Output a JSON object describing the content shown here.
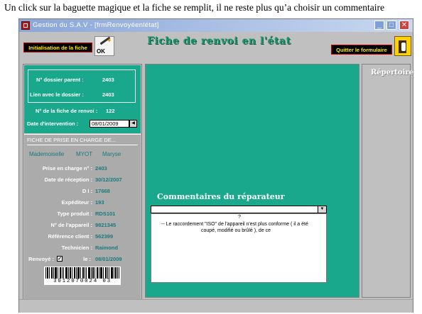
{
  "caption": "Un click sur la baguette magique et la fiche se remplit, il ne reste plus qu’a choisir un commentaire",
  "window": {
    "title": "Gestion du S.A.V - [frmRenvoyéenlétat]",
    "minimize": "_",
    "maximize": "□",
    "close": "✕"
  },
  "toolbar": {
    "init_button": "Initialisation de la fiche",
    "wand_label": "OK",
    "main_title": "Fiche de renvoi en l'état",
    "quit_button": "Quitter le formulaire"
  },
  "dossier": {
    "parent_label": "N° dossier parent :",
    "parent_value": "2403",
    "link_label": "Lien avec le dossier :",
    "link_value": "2403",
    "fiche_label": "N° de la fiche de renvoi :",
    "fiche_value": "122",
    "date_label": "Date d'intervention :",
    "date_value": "08/01/2009"
  },
  "prise_en_charge": {
    "header": "FICHE DE PRISE EN CHARGE DE...",
    "civility": "Mademoiselle",
    "lastname": "MYOT",
    "firstname": "Maryse",
    "fields": [
      {
        "label": "Prise en charge n° :",
        "value": "2403"
      },
      {
        "label": "Date de réception :",
        "value": "30/12/2007"
      },
      {
        "label": "D I :",
        "value": "17668"
      },
      {
        "label": "Expéditeur :",
        "value": "193"
      },
      {
        "label": "Type produit :",
        "value": "RDS101"
      },
      {
        "label": "N° de l'appareil :",
        "value": "9821345"
      },
      {
        "label": "Référence client :",
        "value": "562399"
      },
      {
        "label": "Technicien :",
        "value": "Raimond"
      }
    ],
    "renvoye_label": "Renvoyé :",
    "renvoye_checked": "✓",
    "le_label": "le :",
    "le_value": "08/01/2009",
    "barcode_digits": "3012070024 03"
  },
  "comments": {
    "title": "Commentaires du réparateur",
    "question_mark": "?",
    "line1": "-- Le raccordement \"ISO\" de l'appareil n'est plus conforme ( il a été",
    "line2": "coupé, modifié ou brûlé ), de ce"
  },
  "right": {
    "repertoire": "Répertoire"
  }
}
